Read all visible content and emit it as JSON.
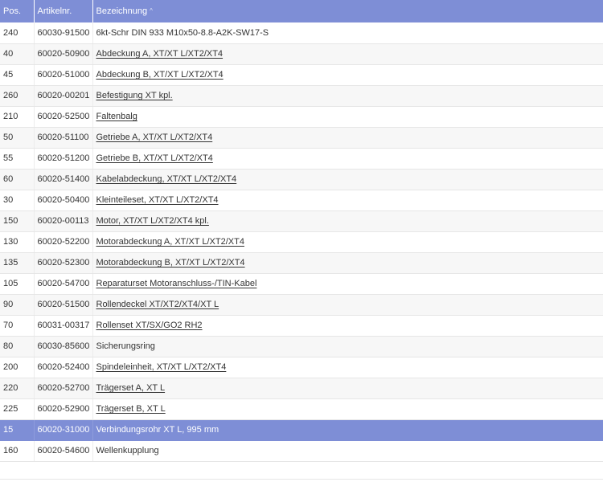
{
  "columns": {
    "pos": "Pos.",
    "artikelnr": "Artikelnr.",
    "bezeichnung": "Bezeichnung",
    "sort_indicator": "^"
  },
  "rows": [
    {
      "pos": "240",
      "artikelnr": "60030-91500",
      "bezeichnung": "6kt-Schr DIN 933 M10x50-8.8-A2K-SW17-S",
      "link": false,
      "selected": false
    },
    {
      "pos": "40",
      "artikelnr": "60020-50900",
      "bezeichnung": "Abdeckung A, XT/XT L/XT2/XT4",
      "link": true,
      "selected": false
    },
    {
      "pos": "45",
      "artikelnr": "60020-51000",
      "bezeichnung": "Abdeckung B, XT/XT L/XT2/XT4",
      "link": true,
      "selected": false
    },
    {
      "pos": "260",
      "artikelnr": "60020-00201",
      "bezeichnung": "Befestigung XT kpl.",
      "link": true,
      "selected": false
    },
    {
      "pos": "210",
      "artikelnr": "60020-52500",
      "bezeichnung": "Faltenbalg",
      "link": true,
      "selected": false
    },
    {
      "pos": "50",
      "artikelnr": "60020-51100",
      "bezeichnung": "Getriebe A, XT/XT L/XT2/XT4",
      "link": true,
      "selected": false
    },
    {
      "pos": "55",
      "artikelnr": "60020-51200",
      "bezeichnung": "Getriebe B, XT/XT L/XT2/XT4",
      "link": true,
      "selected": false
    },
    {
      "pos": "60",
      "artikelnr": "60020-51400",
      "bezeichnung": "Kabelabdeckung, XT/XT L/XT2/XT4",
      "link": true,
      "selected": false
    },
    {
      "pos": "30",
      "artikelnr": "60020-50400",
      "bezeichnung": "Kleinteileset, XT/XT L/XT2/XT4",
      "link": true,
      "selected": false
    },
    {
      "pos": "150",
      "artikelnr": "60020-00113",
      "bezeichnung": "Motor, XT/XT L/XT2/XT4 kpl.",
      "link": true,
      "selected": false
    },
    {
      "pos": "130",
      "artikelnr": "60020-52200",
      "bezeichnung": "Motorabdeckung A, XT/XT L/XT2/XT4",
      "link": true,
      "selected": false
    },
    {
      "pos": "135",
      "artikelnr": "60020-52300",
      "bezeichnung": "Motorabdeckung B, XT/XT L/XT2/XT4",
      "link": true,
      "selected": false
    },
    {
      "pos": "105",
      "artikelnr": "60020-54700",
      "bezeichnung": "Reparaturset Motoranschluss-/TIN-Kabel",
      "link": true,
      "selected": false
    },
    {
      "pos": "90",
      "artikelnr": "60020-51500",
      "bezeichnung": "Rollendeckel XT/XT2/XT4/XT L",
      "link": true,
      "selected": false
    },
    {
      "pos": "70",
      "artikelnr": "60031-00317",
      "bezeichnung": "Rollenset XT/SX/GO2 RH2",
      "link": true,
      "selected": false
    },
    {
      "pos": "80",
      "artikelnr": "60030-85600",
      "bezeichnung": "Sicherungsring",
      "link": false,
      "selected": false
    },
    {
      "pos": "200",
      "artikelnr": "60020-52400",
      "bezeichnung": "Spindeleinheit, XT/XT L/XT2/XT4",
      "link": true,
      "selected": false
    },
    {
      "pos": "220",
      "artikelnr": "60020-52700",
      "bezeichnung": "Trägerset A, XT L",
      "link": true,
      "selected": false
    },
    {
      "pos": "225",
      "artikelnr": "60020-52900",
      "bezeichnung": "Trägerset B, XT L",
      "link": true,
      "selected": false
    },
    {
      "pos": "15",
      "artikelnr": "60020-31000",
      "bezeichnung": "Verbindungsrohr XT L, 995 mm",
      "link": false,
      "selected": true
    },
    {
      "pos": "160",
      "artikelnr": "60020-54600",
      "bezeichnung": "Wellenkupplung",
      "link": false,
      "selected": false
    }
  ],
  "colors": {
    "header_bg": "#7e8ed6",
    "selected_bg": "#7e8ed6",
    "row_alt_bg": "#f7f7f7",
    "text": "#333333"
  }
}
